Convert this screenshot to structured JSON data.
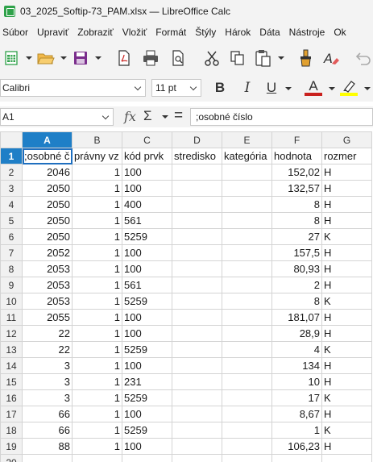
{
  "window": {
    "title": "03_2025_Softip-73_PAM.xlsx — LibreOffice Calc"
  },
  "menu": [
    "Súbor",
    "Upraviť",
    "Zobraziť",
    "Vložiť",
    "Formát",
    "Štýly",
    "Hárok",
    "Dáta",
    "Nástroje",
    "Ok"
  ],
  "toolbar": {
    "icons": [
      "new-spreadsheet-icon",
      "open-folder-icon",
      "save-icon",
      "export-pdf-icon",
      "print-icon",
      "print-preview-icon",
      "cut-icon",
      "copy-icon",
      "paste-icon",
      "clone-formatting-icon",
      "clear-formatting-icon",
      "undo-icon"
    ]
  },
  "format": {
    "font_name": "Calibri",
    "font_size": "11 pt",
    "bold": "B",
    "italic": "I",
    "underline": "U",
    "font_color_glyph": "A",
    "colors": {
      "font_color": "#c9211e",
      "highlight": "#ffff00",
      "accent": "#1f7fc7"
    }
  },
  "formula": {
    "name_box": "A1",
    "fx": "𝑓x",
    "sigma": "Σ",
    "equals": "=",
    "content": ";osobné číslo"
  },
  "sheet": {
    "columns": [
      "A",
      "B",
      "C",
      "D",
      "E",
      "F",
      "G"
    ],
    "rows": [
      {
        "n": "1",
        "cells": [
          ";osobné č",
          "právny vz",
          "kód prvk",
          "stredisko",
          "kategória",
          "hodnota",
          "rozmer"
        ]
      },
      {
        "n": "2",
        "cells": [
          "2046",
          "1",
          "100",
          "",
          "",
          "152,02",
          "H"
        ]
      },
      {
        "n": "3",
        "cells": [
          "2050",
          "1",
          "100",
          "",
          "",
          "132,57",
          "H"
        ]
      },
      {
        "n": "4",
        "cells": [
          "2050",
          "1",
          "400",
          "",
          "",
          "8",
          "H"
        ]
      },
      {
        "n": "5",
        "cells": [
          "2050",
          "1",
          "561",
          "",
          "",
          "8",
          "H"
        ]
      },
      {
        "n": "6",
        "cells": [
          "2050",
          "1",
          "5259",
          "",
          "",
          "27",
          "K"
        ]
      },
      {
        "n": "7",
        "cells": [
          "2052",
          "1",
          "100",
          "",
          "",
          "157,5",
          "H"
        ]
      },
      {
        "n": "8",
        "cells": [
          "2053",
          "1",
          "100",
          "",
          "",
          "80,93",
          "H"
        ]
      },
      {
        "n": "9",
        "cells": [
          "2053",
          "1",
          "561",
          "",
          "",
          "2",
          "H"
        ]
      },
      {
        "n": "10",
        "cells": [
          "2053",
          "1",
          "5259",
          "",
          "",
          "8",
          "K"
        ]
      },
      {
        "n": "11",
        "cells": [
          "2055",
          "1",
          "100",
          "",
          "",
          "181,07",
          "H"
        ]
      },
      {
        "n": "12",
        "cells": [
          "22",
          "1",
          "100",
          "",
          "",
          "28,9",
          "H"
        ]
      },
      {
        "n": "13",
        "cells": [
          "22",
          "1",
          "5259",
          "",
          "",
          "4",
          "K"
        ]
      },
      {
        "n": "14",
        "cells": [
          "3",
          "1",
          "100",
          "",
          "",
          "134",
          "H"
        ]
      },
      {
        "n": "15",
        "cells": [
          "3",
          "1",
          "231",
          "",
          "",
          "10",
          "H"
        ]
      },
      {
        "n": "16",
        "cells": [
          "3",
          "1",
          "5259",
          "",
          "",
          "17",
          "K"
        ]
      },
      {
        "n": "17",
        "cells": [
          "66",
          "1",
          "100",
          "",
          "",
          "8,67",
          "H"
        ]
      },
      {
        "n": "18",
        "cells": [
          "66",
          "1",
          "5259",
          "",
          "",
          "1",
          "K"
        ]
      },
      {
        "n": "19",
        "cells": [
          "88",
          "1",
          "100",
          "",
          "",
          "106,23",
          "H"
        ]
      },
      {
        "n": "20",
        "cells": [
          "",
          "",
          "",
          "",
          "",
          "",
          ""
        ]
      }
    ]
  }
}
